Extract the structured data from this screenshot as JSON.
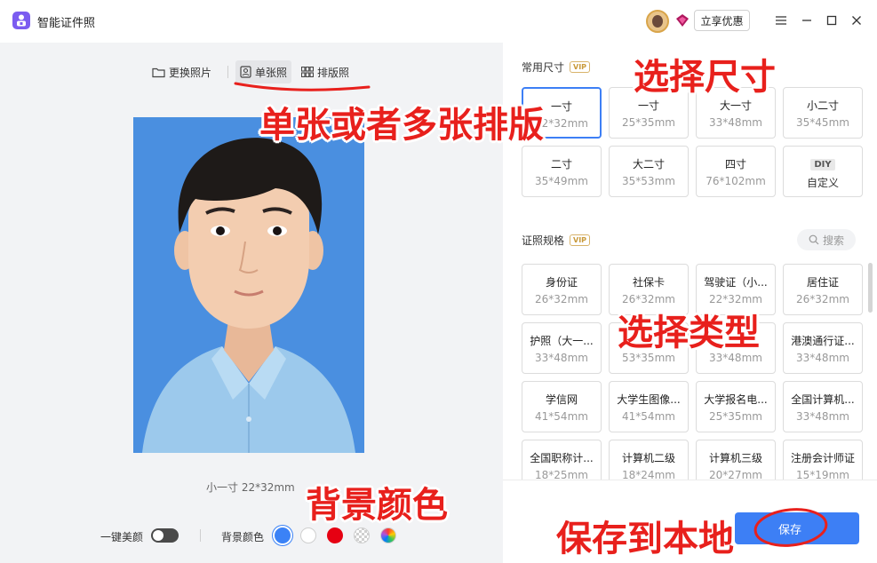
{
  "window": {
    "title": "智能证件照",
    "promo_button": "立享优惠",
    "controls": [
      "menu-icon",
      "minimize-icon",
      "maximize-icon",
      "close-icon"
    ]
  },
  "toolbar": {
    "replace_photo": "更换照片",
    "single_photo": "单张照",
    "layout_photo": "排版照"
  },
  "preview": {
    "size_caption": "小一寸 22*32mm"
  },
  "bottom_bar": {
    "beauty_label": "一键美颜",
    "beauty_on": false,
    "bg_label": "背景颜色",
    "swatches": [
      {
        "color": "#3b82f6",
        "selected": true
      },
      {
        "color": "#ffffff",
        "selected": false
      },
      {
        "color": "#e60012",
        "selected": false
      },
      {
        "color": "transparent",
        "selected": false
      },
      {
        "color": "gradient",
        "selected": false
      }
    ]
  },
  "common_sizes": {
    "title": "常用尺寸",
    "vip": "VIP",
    "items": [
      {
        "name": "一寸",
        "dim": "22*32mm",
        "selected": true
      },
      {
        "name": "一寸",
        "dim": "25*35mm"
      },
      {
        "name": "大一寸",
        "dim": "33*48mm"
      },
      {
        "name": "小二寸",
        "dim": "35*45mm"
      },
      {
        "name": "二寸",
        "dim": "35*49mm"
      },
      {
        "name": "大二寸",
        "dim": "35*53mm"
      },
      {
        "name": "四寸",
        "dim": "76*102mm"
      },
      {
        "name": "自定义",
        "dim": "",
        "badge": "DIY"
      }
    ]
  },
  "spec_sizes": {
    "title": "证照规格",
    "vip": "VIP",
    "search_placeholder": "搜索",
    "items": [
      {
        "name": "身份证",
        "dim": "26*32mm"
      },
      {
        "name": "社保卡",
        "dim": "26*32mm"
      },
      {
        "name": "驾驶证（小...",
        "dim": "22*32mm"
      },
      {
        "name": "居住证",
        "dim": "26*32mm"
      },
      {
        "name": "护照（大一...",
        "dim": "33*48mm"
      },
      {
        "name": "",
        "dim": "53*35mm"
      },
      {
        "name": "",
        "dim": "33*48mm"
      },
      {
        "name": "港澳通行证...",
        "dim": "33*48mm"
      },
      {
        "name": "学信网",
        "dim": "41*54mm"
      },
      {
        "name": "大学生图像...",
        "dim": "41*54mm"
      },
      {
        "name": "大学报名电...",
        "dim": "25*35mm"
      },
      {
        "name": "全国计算机...",
        "dim": "33*48mm"
      },
      {
        "name": "全国职称计...",
        "dim": "18*25mm"
      },
      {
        "name": "计算机二级",
        "dim": "18*24mm"
      },
      {
        "name": "计算机三级",
        "dim": "20*27mm"
      },
      {
        "name": "注册会计师证",
        "dim": "15*19mm"
      }
    ]
  },
  "save_button": "保存",
  "annotations": {
    "select_size": "选择尺寸",
    "layout_mode": "单张或者多张排版",
    "select_type": "选择类型",
    "bg_color": "背景颜色",
    "save_local": "保存到本地"
  }
}
